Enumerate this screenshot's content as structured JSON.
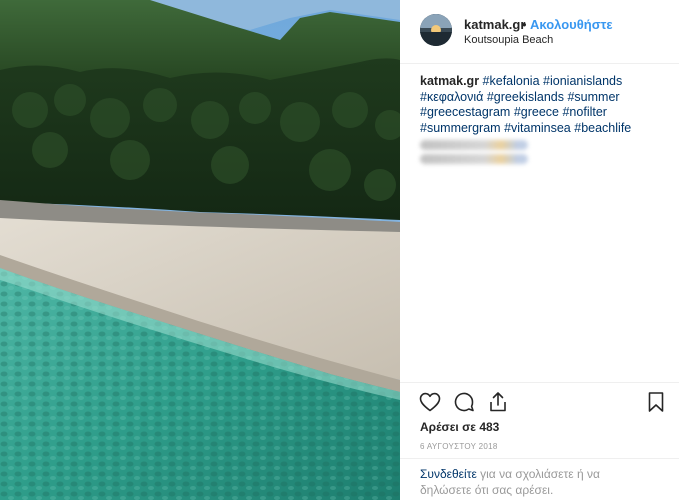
{
  "post": {
    "username": "katmak.gr",
    "separator": "•",
    "follow_label": "Ακολουθήστε",
    "location": "Koutsoupia Beach",
    "caption_username": "katmak.gr",
    "hashtags": [
      "#kefalonia",
      "#ionianislands",
      "#κεφαλονιά",
      "#greekislands",
      "#summer",
      "#greecestagram",
      "#greece",
      "#nofilter",
      "#summergram",
      "#vitaminsea",
      "#beachlife"
    ],
    "likes_text": "Αρέσει σε 483",
    "date_text": "6 ΑΥΓΟΥΣΤΟΥ 2018",
    "login_link": "Συνδεθείτε",
    "login_text": " για να σχολιάσετε ή να δηλώσετε ότι σας αρέσει."
  },
  "icons": {
    "like": "heart-icon",
    "comment": "comment-icon",
    "share": "share-icon",
    "save": "bookmark-icon"
  },
  "colors": {
    "link": "#3897f0",
    "hashtag": "#003569",
    "muted": "#999999",
    "text": "#262626"
  }
}
